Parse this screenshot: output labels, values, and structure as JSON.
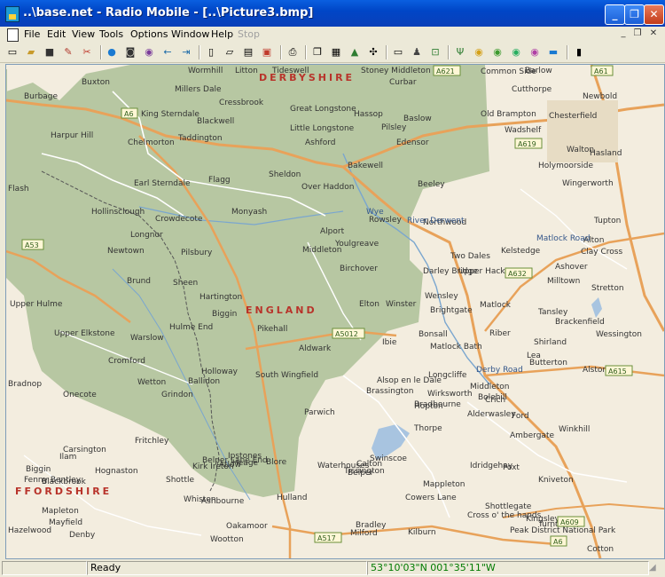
{
  "window": {
    "title": "..\\base.net - Radio Mobile - [..\\Picture3.bmp]"
  },
  "menu": [
    "File",
    "Edit",
    "View",
    "Tools",
    "Options",
    "Window",
    "Help",
    "Stop"
  ],
  "toolbar_icons": [
    "new-map",
    "open",
    "save",
    "properties",
    "networks-properties",
    "world-map",
    "elevation",
    "find",
    "back",
    "forward",
    "picture-properties",
    "merge",
    "export",
    "pdf",
    "print",
    "copy",
    "paste",
    "stack",
    "fit",
    "window",
    "find-best-site",
    "cover",
    "link",
    "radio-link",
    "coverage-polar",
    "coverage-single",
    "coverage-combined",
    "interference",
    "visual",
    "pipe"
  ],
  "status": {
    "message": "Ready",
    "coordinates": "53°10'03\"N 001°35'11\"W"
  },
  "map": {
    "region_labels": [
      "DERBYSHIRE",
      "ENGLAND",
      "FFORDSHIRE"
    ],
    "road_labels": [
      "A6",
      "A621",
      "A619",
      "A53",
      "A632",
      "A5012",
      "A615",
      "A517",
      "A6",
      "A609",
      "A61",
      "Derby Road",
      "Matlock Road",
      "River Derwent",
      "Wye"
    ],
    "towns": [
      "Wormhill",
      "Litton",
      "Tideswell",
      "Stoney Middleton",
      "Curbar",
      "Common Side",
      "Barlow",
      "Burbage",
      "Buxton",
      "Millers Dale",
      "Cressbrook",
      "Cutthorpe",
      "Newbold",
      "King Sterndale",
      "Blackwell",
      "Great Longstone",
      "Hassop",
      "Baslow",
      "Old Brampton",
      "Chesterfield",
      "Harpur Hill",
      "Chelmorton",
      "Taddington",
      "Little Longstone",
      "Pilsley",
      "Edensor",
      "Wadshelf",
      "Ashford",
      "Walton",
      "Hasland",
      "Holymoorside",
      "Flash",
      "Earl Sterndale",
      "Flagg",
      "Sheldon",
      "Bakewell",
      "Beeley",
      "Over Haddon",
      "Wingerworth",
      "Hollinsclough",
      "Monyash",
      "Rowsley",
      "Northwood",
      "Tupton",
      "Crowdecote",
      "Longnor",
      "Alport",
      "Youlgreave",
      "Alton",
      "Newtown",
      "Pilsbury",
      "Middleton",
      "Two Dales",
      "Kelstedge",
      "Clay Cross",
      "Darley Bridge",
      "Upper Hackney",
      "Ashover",
      "Brund",
      "Sheen",
      "Birchover",
      "Milltown",
      "Stretton",
      "Upper Hulme",
      "Hartington",
      "Elton",
      "Winster",
      "Matlock",
      "Tansley",
      "Biggin",
      "Wensley",
      "Brightgate",
      "Brackenfield",
      "Hulme End",
      "Pikehall",
      "Upper Elkstone",
      "Warslow",
      "Ibie",
      "Bonsall",
      "Matlock Bath",
      "Riber",
      "Shirland",
      "Wessington",
      "Aldwark",
      "Lea",
      "Butterton",
      "Alstonfield",
      "Cromford",
      "Holloway",
      "South Wingfield",
      "Alsop en le Dale",
      "Longcliffe",
      "Middleton",
      "Bolehill",
      "Bradnop",
      "Wetton",
      "Ballidon",
      "Brassington",
      "Wirksworth",
      "Crich",
      "Onecote",
      "Grindon",
      "Parwich",
      "Hopton",
      "Alderwasley",
      "Ford",
      "Carsington",
      "Fritchley",
      "Tissington",
      "Bradbourne",
      "Ambergate",
      "Winkhill",
      "Ilam",
      "Belper Lane End",
      "Heage",
      "Calton",
      "Thorpe",
      "Fenny Bentley",
      "Hognaston",
      "Kirk Ireton",
      "Ipstones",
      "Waterhouses",
      "Kniveton",
      "Shottle",
      "Atlow",
      "Blore",
      "Swinscoe",
      "Mappleton",
      "Idridgehay",
      "Biggin",
      "Blackbrook",
      "Belper",
      "Foxt",
      "Whiston",
      "Ashbourne",
      "Hulland",
      "Cowers Lane",
      "Shottlegate",
      "Kingsley",
      "Cotton",
      "Mapleton",
      "Mayfield",
      "Bradley",
      "Cross o' the hands",
      "Turnditch",
      "Hazelwood",
      "Denby",
      "Oakamoor",
      "Wootton",
      "Milford",
      "Kilburn",
      "Peak District National Park"
    ]
  }
}
